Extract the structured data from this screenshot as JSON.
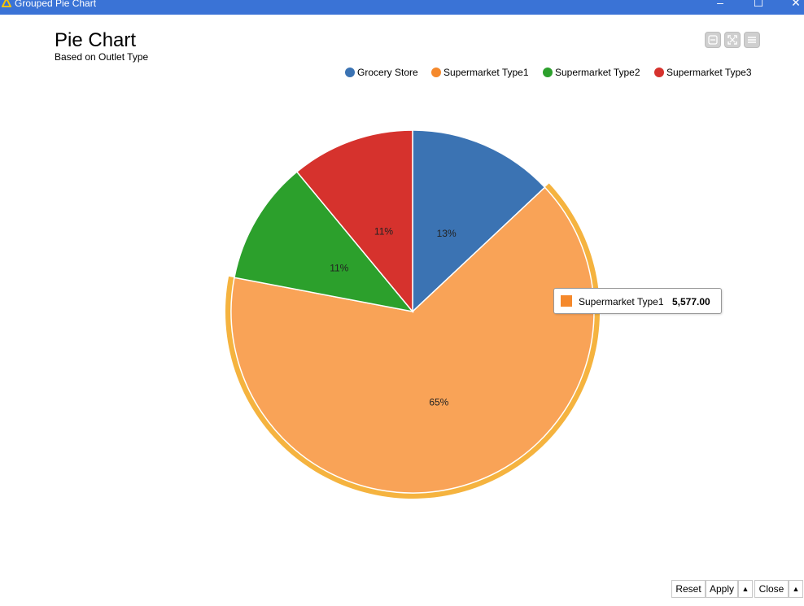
{
  "window": {
    "title": "Grouped Pie Chart",
    "minimize_glyph": "–",
    "maximize_glyph": "☐",
    "close_glyph": "✕",
    "accent_color": "#3a73d6"
  },
  "chart": {
    "title": "Pie Chart",
    "subtitle": "Based on Outlet Type",
    "tool_icons": [
      "collapse-icon",
      "fullscreen-icon",
      "menu-icon"
    ]
  },
  "legend": {
    "items": [
      {
        "label": "Grocery Store",
        "color": "#3b73b3"
      },
      {
        "label": "Supermarket Type1",
        "color": "#f5892c"
      },
      {
        "label": "Supermarket Type2",
        "color": "#2ca02c"
      },
      {
        "label": "Supermarket Type3",
        "color": "#d6322d"
      }
    ]
  },
  "tooltip": {
    "label": "Supermarket Type1",
    "value": "5,577.00",
    "color": "#f5892c"
  },
  "footer": {
    "reset_label": "Reset",
    "apply_label": "Apply",
    "apply_arrow": "▲",
    "close_label": "Close",
    "close_arrow": "▲"
  },
  "chart_data": {
    "type": "pie",
    "title": "Pie Chart",
    "subtitle": "Based on Outlet Type",
    "legend_position": "top-right",
    "categories": [
      "Grocery Store",
      "Supermarket Type1",
      "Supermarket Type2",
      "Supermarket Type3"
    ],
    "percent_labels": [
      "13%",
      "65%",
      "11%",
      "11%"
    ],
    "values": [
      13,
      65,
      11,
      11
    ],
    "colors": [
      "#3b73b3",
      "#f9a357",
      "#2ca02c",
      "#d6322d"
    ],
    "highlighted": "Supermarket Type1",
    "highlight_value": 5577.0
  }
}
